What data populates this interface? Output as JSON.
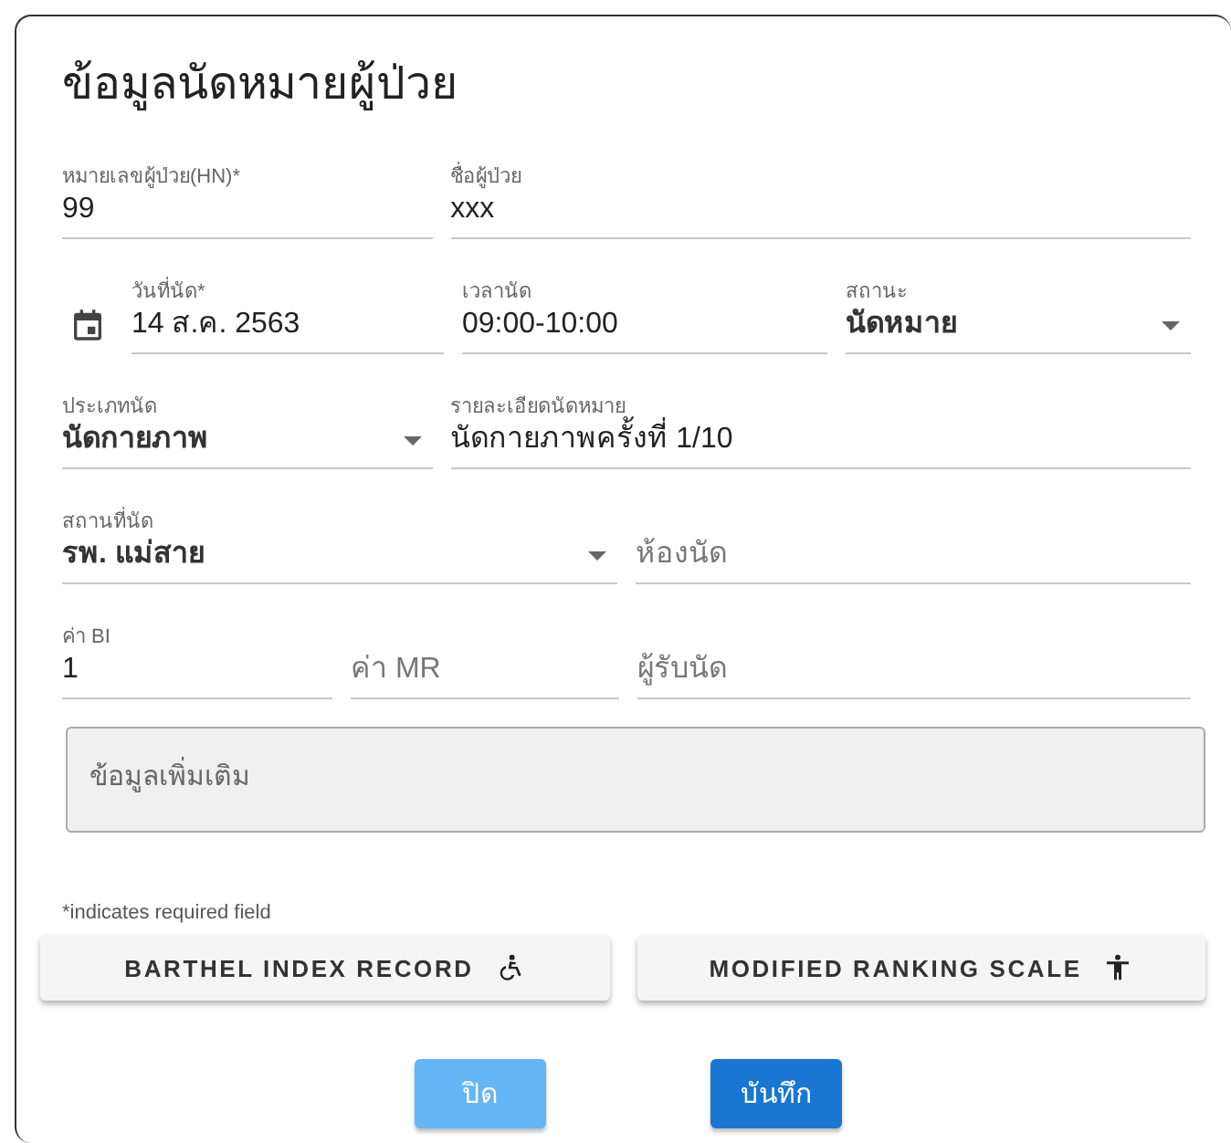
{
  "dialog": {
    "title": "ข้อมูลนัดหมายผู้ป่วย"
  },
  "rows": [
    [
      {
        "kind": "text",
        "label": "หมายเลขผู้ป่วย(HN)*",
        "value": "99"
      },
      {
        "kind": "text",
        "label": "ชื่อผู้ป่วย",
        "value": "xxx"
      }
    ],
    [
      {
        "kind": "date",
        "label": "วันที่นัด*",
        "value": "14 ส.ค. 2563"
      },
      {
        "kind": "text",
        "label": "เวลานัด",
        "value": "09:00-10:00"
      },
      {
        "kind": "select",
        "label": "สถานะ",
        "value": "นัดหมาย"
      }
    ],
    [
      {
        "kind": "select",
        "label": "ประเภทนัด",
        "value": "นัดกายภาพ"
      },
      {
        "kind": "text",
        "label": "รายละเอียดนัดหมาย",
        "value": "นัดกายภาพครั้งที่ 1/10"
      }
    ],
    [
      {
        "kind": "select",
        "label": "สถานที่นัด",
        "value": "รพ. แม่สาย"
      },
      {
        "kind": "text",
        "placeholder": "ห้องนัด"
      }
    ],
    [
      {
        "kind": "text",
        "label": "ค่า BI",
        "value": "1"
      },
      {
        "kind": "text",
        "placeholder": "ค่า MR"
      },
      {
        "kind": "text",
        "placeholder": "ผู้รับนัด"
      }
    ]
  ],
  "notes": {
    "placeholder": "ข้อมูลเพิ่มเติม"
  },
  "required_note": "*indicates required field",
  "record_buttons": [
    {
      "label": "BARTHEL INDEX RECORD"
    },
    {
      "label": "MODIFIED RANKING SCALE"
    }
  ],
  "actions": [
    {
      "label": "ปิด",
      "disabled": true
    },
    {
      "label": "บันทึก",
      "disabled": false
    }
  ]
}
